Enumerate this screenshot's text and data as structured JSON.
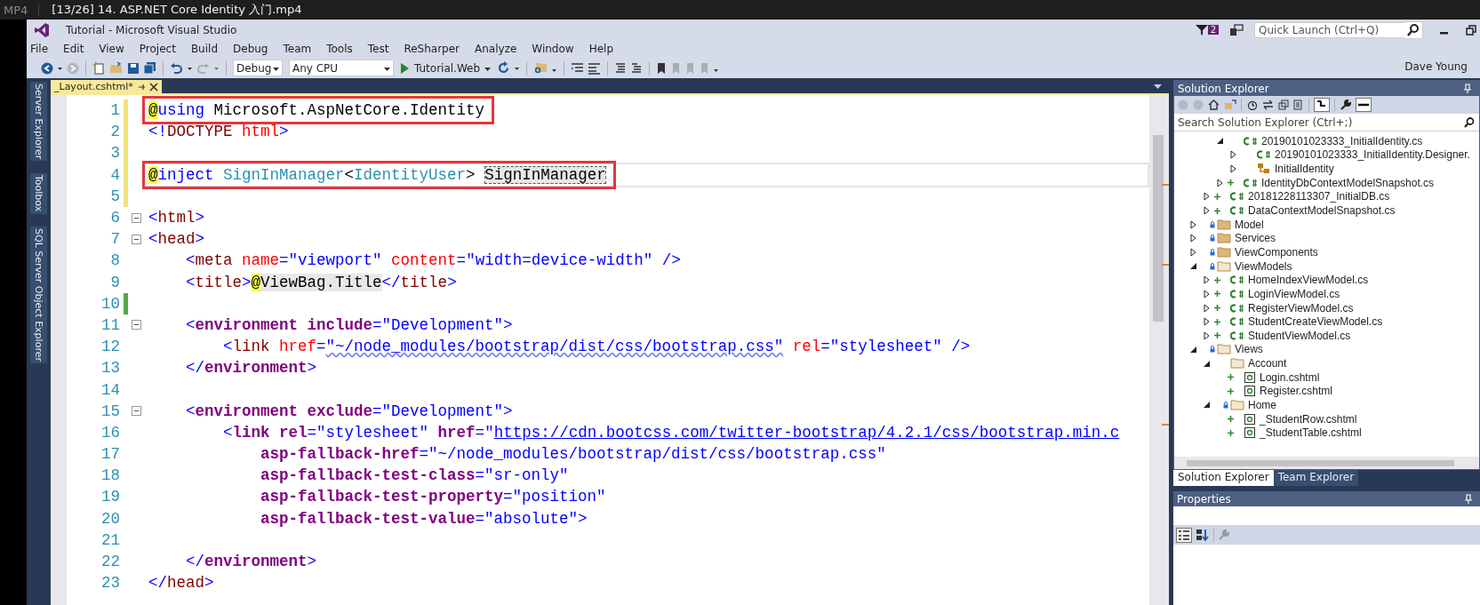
{
  "player": {
    "format": "MP4",
    "title": "[13/26] 14. ASP.NET Core Identity 入门.mp4"
  },
  "window": {
    "title": "Tutorial - Microsoft Visual Studio",
    "notification_count": "2",
    "quick_launch": {
      "placeholder": "Quick Launch (Ctrl+Q)"
    },
    "user": "Dave Young"
  },
  "menu": [
    "File",
    "Edit",
    "View",
    "Project",
    "Build",
    "Debug",
    "Team",
    "Tools",
    "Test",
    "ReSharper",
    "Analyze",
    "Window",
    "Help"
  ],
  "toolbar": {
    "configuration": "Debug",
    "platform": "Any CPU",
    "startup": "Tutorial.Web"
  },
  "side_tabs": [
    "Server Explorer",
    "Toolbox",
    "SQL Server Object Explorer"
  ],
  "editor": {
    "tabs": [
      {
        "label": "_Layout.cshtml*",
        "selected": true
      }
    ],
    "lines": [
      {
        "number": "1",
        "modified": true,
        "saved": false,
        "fold": false,
        "current": false,
        "boxed": true,
        "tokens": [
          {
            "kind": "at",
            "text": "@"
          },
          {
            "kind": "kw",
            "text": "using"
          },
          {
            "kind": "p",
            "text": " Microsoft.AspNetCore.Identity"
          }
        ]
      },
      {
        "number": "2",
        "modified": true,
        "saved": false,
        "fold": false,
        "current": false,
        "boxed": false,
        "tokens": [
          {
            "kind": "d",
            "text": "<!"
          },
          {
            "kind": "tg",
            "text": "DOCTYPE"
          },
          {
            "kind": "an",
            "text": " html"
          },
          {
            "kind": "d",
            "text": ">"
          }
        ]
      },
      {
        "number": "3",
        "modified": true,
        "saved": false,
        "fold": false,
        "current": false,
        "boxed": false
      },
      {
        "number": "4",
        "modified": true,
        "saved": false,
        "fold": false,
        "current": true,
        "boxed": true,
        "tokens": [
          {
            "kind": "at",
            "text": "@"
          },
          {
            "kind": "kw",
            "text": "inject"
          },
          {
            "kind": "ty",
            "text": " SignInManager"
          },
          {
            "kind": "p",
            "text": "<"
          },
          {
            "kind": "ty",
            "text": "IdentityUser"
          },
          {
            "kind": "p",
            "text": "> "
          },
          {
            "kind": "rf",
            "text": "SignInManager"
          }
        ]
      },
      {
        "number": "5",
        "modified": true,
        "saved": false,
        "fold": false,
        "current": false,
        "boxed": false
      },
      {
        "number": "6",
        "modified": false,
        "saved": false,
        "fold": true,
        "current": false,
        "boxed": false,
        "tokens": [
          {
            "kind": "d",
            "text": "<"
          },
          {
            "kind": "tg",
            "text": "html"
          },
          {
            "kind": "d",
            "text": ">"
          }
        ]
      },
      {
        "number": "7",
        "modified": false,
        "saved": false,
        "fold": true,
        "current": false,
        "boxed": false,
        "tokens": [
          {
            "kind": "d",
            "text": "<"
          },
          {
            "kind": "tg",
            "text": "head"
          },
          {
            "kind": "d",
            "text": ">"
          }
        ],
        "children": [
          {
            "number": "8",
            "modified": false,
            "saved": false,
            "fold": false,
            "current": false,
            "boxed": false,
            "tokens": [
              {
                "kind": "d",
                "text": "<"
              },
              {
                "kind": "tg",
                "text": "meta"
              },
              {
                "kind": "an",
                "text": " name"
              },
              {
                "kind": "d",
                "text": "="
              },
              {
                "kind": "sv",
                "text": "\"viewport\""
              },
              {
                "kind": "an",
                "text": " content"
              },
              {
                "kind": "d",
                "text": "="
              },
              {
                "kind": "sv",
                "text": "\"width=device-width\""
              },
              {
                "kind": "d",
                "text": " />"
              }
            ]
          },
          {
            "number": "9",
            "modified": false,
            "saved": false,
            "fold": false,
            "current": false,
            "boxed": false,
            "tokens": [
              {
                "kind": "d",
                "text": "<"
              },
              {
                "kind": "tg",
                "text": "title"
              },
              {
                "kind": "d",
                "text": ">"
              },
              {
                "kind": "at",
                "text": "@"
              },
              {
                "kind": "rz",
                "text": "ViewBag.Title"
              },
              {
                "kind": "d",
                "text": "</"
              },
              {
                "kind": "tg",
                "text": "title"
              },
              {
                "kind": "d",
                "text": ">"
              }
            ]
          },
          {
            "number": "10",
            "modified": true,
            "saved": true,
            "fold": false,
            "current": false,
            "boxed": false
          },
          {
            "number": "11",
            "modified": false,
            "saved": false,
            "fold": true,
            "current": false,
            "boxed": false,
            "tokens": [
              {
                "kind": "d",
                "text": "<"
              },
              {
                "kind": "th",
                "text": "environment"
              },
              {
                "kind": "ta",
                "text": " include"
              },
              {
                "kind": "d",
                "text": "="
              },
              {
                "kind": "sv",
                "text": "\"Development\""
              },
              {
                "kind": "d",
                "text": ">"
              }
            ],
            "children": [
              {
                "number": "12",
                "modified": false,
                "saved": false,
                "fold": false,
                "current": false,
                "boxed": false,
                "tokens": [
                  {
                    "kind": "d",
                    "text": "<"
                  },
                  {
                    "kind": "tg",
                    "text": "link"
                  },
                  {
                    "kind": "an",
                    "text": " href"
                  },
                  {
                    "kind": "d",
                    "text": "="
                  },
                  {
                    "kind": "sq",
                    "text": "\"~/node_modules/bootstrap/dist/css/bootstrap.css\""
                  },
                  {
                    "kind": "an",
                    "text": " rel"
                  },
                  {
                    "kind": "d",
                    "text": "="
                  },
                  {
                    "kind": "sv",
                    "text": "\"stylesheet\""
                  },
                  {
                    "kind": "d",
                    "text": " />"
                  }
                ]
              }
            ]
          },
          {
            "number": "13",
            "modified": false,
            "saved": false,
            "fold": false,
            "current": false,
            "boxed": false,
            "tokens": [
              {
                "kind": "d",
                "text": "</"
              },
              {
                "kind": "th",
                "text": "environment"
              },
              {
                "kind": "d",
                "text": ">"
              }
            ]
          },
          {
            "number": "14",
            "modified": false,
            "saved": false,
            "fold": false,
            "current": false,
            "boxed": false
          },
          {
            "number": "15",
            "modified": false,
            "saved": false,
            "fold": true,
            "current": false,
            "boxed": false,
            "tokens": [
              {
                "kind": "d",
                "text": "<"
              },
              {
                "kind": "th",
                "text": "environment"
              },
              {
                "kind": "ta",
                "text": " exclude"
              },
              {
                "kind": "d",
                "text": "="
              },
              {
                "kind": "sv",
                "text": "\"Development\""
              },
              {
                "kind": "d",
                "text": ">"
              }
            ],
            "children": [
              {
                "number": "16",
                "modified": false,
                "saved": false,
                "fold": false,
                "current": false,
                "boxed": false,
                "tokens": [
                  {
                    "kind": "d",
                    "text": "<"
                  },
                  {
                    "kind": "th",
                    "text": "link"
                  },
                  {
                    "kind": "ta",
                    "text": " rel"
                  },
                  {
                    "kind": "d",
                    "text": "="
                  },
                  {
                    "kind": "sv",
                    "text": "\"stylesheet\""
                  },
                  {
                    "kind": "ta",
                    "text": " href"
                  },
                  {
                    "kind": "d",
                    "text": "="
                  },
                  {
                    "kind": "sv",
                    "text": "\""
                  },
                  {
                    "kind": "ln",
                    "text": "https://cdn.bootcss.com/twitter-bootstrap/4.2.1/css/bootstrap.min.c"
                  }
                ],
                "children": [
                  {
                    "number": "17",
                    "modified": false,
                    "saved": false,
                    "fold": false,
                    "current": false,
                    "boxed": false,
                    "tokens": [
                      {
                        "kind": "ta",
                        "text": "asp-fallback-href"
                      },
                      {
                        "kind": "d",
                        "text": "="
                      },
                      {
                        "kind": "sv",
                        "text": "\"~/node_modules/bootstrap/dist/css/bootstrap.css\""
                      }
                    ]
                  },
                  {
                    "number": "18",
                    "modified": false,
                    "saved": false,
                    "fold": false,
                    "current": false,
                    "boxed": false,
                    "tokens": [
                      {
                        "kind": "ta",
                        "text": "asp-fallback-test-class"
                      },
                      {
                        "kind": "d",
                        "text": "="
                      },
                      {
                        "kind": "sv",
                        "text": "\"sr-only\""
                      }
                    ]
                  },
                  {
                    "number": "19",
                    "modified": false,
                    "saved": false,
                    "fold": false,
                    "current": false,
                    "boxed": false,
                    "tokens": [
                      {
                        "kind": "ta",
                        "text": "asp-fallback-test-property"
                      },
                      {
                        "kind": "d",
                        "text": "="
                      },
                      {
                        "kind": "sv",
                        "text": "\"position\""
                      }
                    ]
                  },
                  {
                    "number": "20",
                    "modified": false,
                    "saved": false,
                    "fold": false,
                    "current": false,
                    "boxed": false,
                    "tokens": [
                      {
                        "kind": "ta",
                        "text": "asp-fallback-test-value"
                      },
                      {
                        "kind": "d",
                        "text": "="
                      },
                      {
                        "kind": "sv",
                        "text": "\"absolute\""
                      },
                      {
                        "kind": "d",
                        "text": ">"
                      }
                    ]
                  }
                ]
              }
            ]
          },
          {
            "number": "21",
            "modified": false,
            "saved": false,
            "fold": false,
            "current": false,
            "boxed": false
          },
          {
            "number": "22",
            "modified": false,
            "saved": false,
            "fold": false,
            "current": false,
            "boxed": false,
            "tokens": [
              {
                "kind": "d",
                "text": "</"
              },
              {
                "kind": "th",
                "text": "environment"
              },
              {
                "kind": "d",
                "text": ">"
              }
            ]
          }
        ]
      },
      {
        "number": "23",
        "modified": false,
        "saved": false,
        "fold": false,
        "current": false,
        "boxed": false,
        "tokens": [
          {
            "kind": "d",
            "text": "</"
          },
          {
            "kind": "tg",
            "text": "head"
          },
          {
            "kind": "d",
            "text": ">"
          }
        ]
      }
    ]
  },
  "solution_explorer": {
    "title": "Solution Explorer",
    "search": {
      "placeholder": "Search Solution Explorer (Ctrl+;)"
    },
    "tree": [
      {
        "children": [
          {
            "children": [
              {
                "label": "20190101023333_InitialIdentity.cs",
                "kind": "code",
                "expanded": true,
                "pending": false,
                "locked": false,
                "children": [
                  {
                    "label": "20190101023333_InitialIdentity.Designer.",
                    "kind": "code",
                    "expanded": false,
                    "pending": false,
                    "locked": false
                  },
                  {
                    "label": "InitialIdentity",
                    "kind": "class",
                    "expanded": false,
                    "pending": false,
                    "locked": false
                  }
                ]
              },
              {
                "label": "IdentityDbContextModelSnapshot.cs",
                "kind": "code",
                "expanded": false,
                "pending": true,
                "locked": false
              }
            ]
          },
          {
            "label": "20181228113307_InitialDB.cs",
            "kind": "code",
            "expanded": false,
            "pending": true,
            "locked": false
          },
          {
            "label": "DataContextModelSnapshot.cs",
            "kind": "code",
            "expanded": false,
            "pending": true,
            "locked": false
          }
        ]
      },
      {
        "label": "Model",
        "kind": "folder",
        "expanded": false,
        "pending": false,
        "locked": true
      },
      {
        "label": "Services",
        "kind": "folder",
        "expanded": false,
        "pending": false,
        "locked": true
      },
      {
        "label": "ViewComponents",
        "kind": "folder",
        "expanded": false,
        "pending": false,
        "locked": true
      },
      {
        "label": "ViewModels",
        "kind": "folder",
        "expanded": true,
        "pending": false,
        "locked": true,
        "children": [
          {
            "label": "HomeIndexViewModel.cs",
            "kind": "code",
            "expanded": false,
            "pending": true,
            "locked": false
          },
          {
            "label": "LoginViewModel.cs",
            "kind": "code",
            "expanded": false,
            "pending": true,
            "locked": false
          },
          {
            "label": "RegisterViewModel.cs",
            "kind": "code",
            "expanded": false,
            "pending": true,
            "locked": false
          },
          {
            "label": "StudentCreateViewModel.cs",
            "kind": "code",
            "expanded": false,
            "pending": true,
            "locked": false
          },
          {
            "label": "StudentViewModel.cs",
            "kind": "code",
            "expanded": false,
            "pending": true,
            "locked": false
          }
        ]
      },
      {
        "label": "Views",
        "kind": "folder",
        "expanded": true,
        "pending": false,
        "locked": true,
        "children": [
          {
            "label": "Account",
            "kind": "folder",
            "expanded": true,
            "pending": false,
            "locked": false,
            "children": [
              {
                "label": "Login.cshtml",
                "kind": "page",
                "pending": true,
                "locked": false
              },
              {
                "label": "Register.cshtml",
                "kind": "page",
                "pending": true,
                "locked": false
              }
            ]
          },
          {
            "label": "Home",
            "kind": "folder",
            "expanded": true,
            "pending": false,
            "locked": true,
            "children": [
              {
                "label": "_StudentRow.cshtml",
                "kind": "page",
                "pending": true,
                "locked": false
              },
              {
                "label": "_StudentTable.cshtml",
                "kind": "page",
                "pending": true,
                "locked": false
              }
            ]
          }
        ]
      }
    ]
  },
  "panel_tabs": [
    {
      "label": "Solution Explorer",
      "selected": true
    },
    {
      "label": "Team Explorer",
      "selected": false
    }
  ],
  "properties": {
    "title": "Properties"
  }
}
